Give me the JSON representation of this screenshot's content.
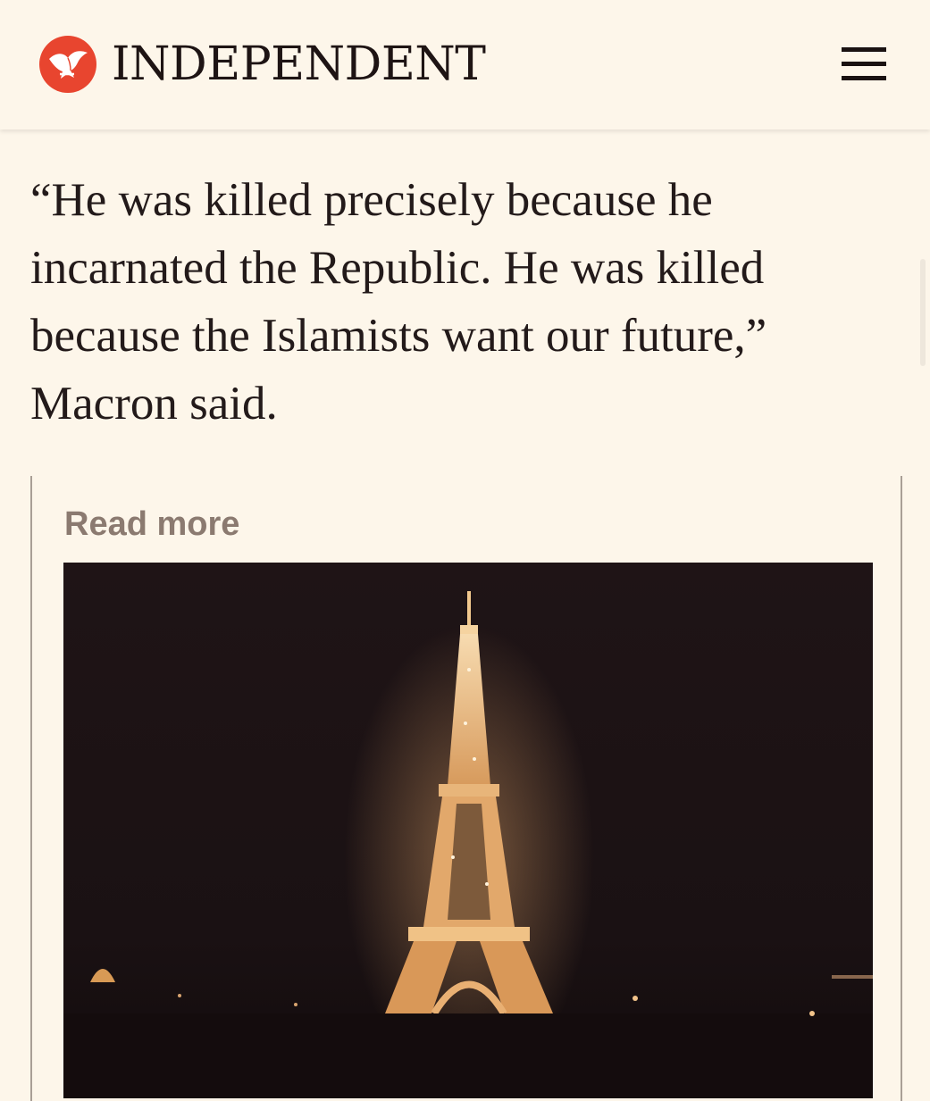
{
  "header": {
    "brand_name": "INDEPENDENT",
    "logo_icon": "eagle-logo-icon",
    "menu_icon": "hamburger-menu-icon"
  },
  "article": {
    "quote": "“He was killed precisely because he incarnated the Republic. He was killed because the Islamists want our future,” Macron said."
  },
  "read_more": {
    "label": "Read more",
    "image_subject": "Eiffel Tower at night"
  },
  "colors": {
    "background": "#fdf6ea",
    "logo_red": "#e8452f",
    "text": "#231a1a",
    "read_more_label": "#8b7a70",
    "border": "#a99f96"
  }
}
